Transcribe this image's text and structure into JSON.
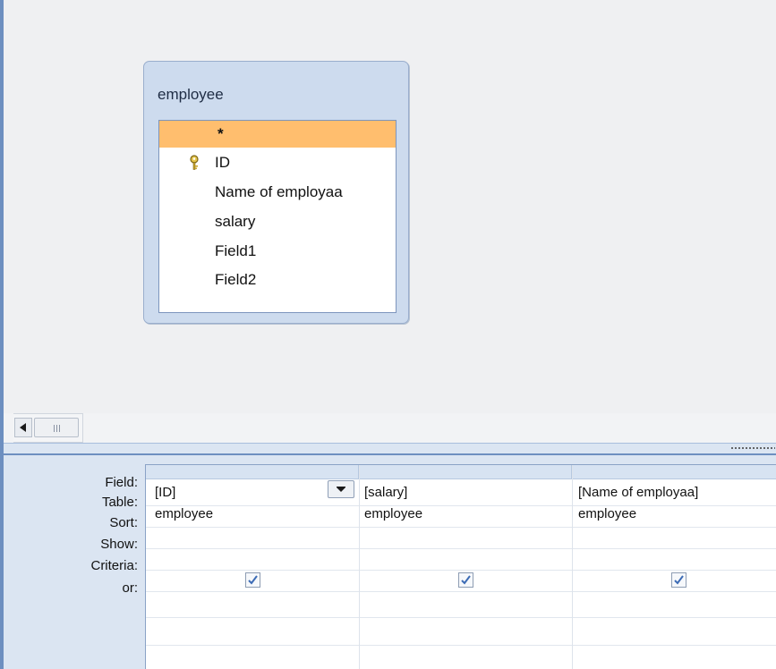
{
  "field_list": {
    "title": "employee",
    "fields": [
      {
        "label": "*",
        "selected": true,
        "primary_key": false
      },
      {
        "label": "ID",
        "selected": false,
        "primary_key": true
      },
      {
        "label": "Name of employaa",
        "selected": false,
        "primary_key": false
      },
      {
        "label": "salary",
        "selected": false,
        "primary_key": false
      },
      {
        "label": "Field1",
        "selected": false,
        "primary_key": false
      },
      {
        "label": "Field2",
        "selected": false,
        "primary_key": false
      }
    ]
  },
  "design_grid": {
    "row_labels": {
      "field": "Field:",
      "table": "Table:",
      "sort": "Sort:",
      "show": "Show:",
      "criteria": "Criteria:",
      "or": "or:"
    },
    "columns": [
      {
        "field": "[ID]",
        "table": "employee",
        "sort": "",
        "show": true,
        "criteria": "",
        "or": ""
      },
      {
        "field": "[salary]",
        "table": "employee",
        "sort": "",
        "show": true,
        "criteria": "",
        "or": ""
      },
      {
        "field": "[Name of employaa]",
        "table": "employee",
        "sort": "",
        "show": true,
        "criteria": "",
        "or": ""
      }
    ]
  },
  "icons": {
    "primary_key": "key-icon",
    "scroll_left": "triangle-left-icon",
    "scroll_grip": "grip-icon",
    "dropdown": "chevron-down-icon",
    "checked": "check-icon"
  },
  "colors": {
    "selected_field": "#ffbe6e",
    "pane_border": "#6d8fc0",
    "check_mark": "#3c6bb5"
  }
}
